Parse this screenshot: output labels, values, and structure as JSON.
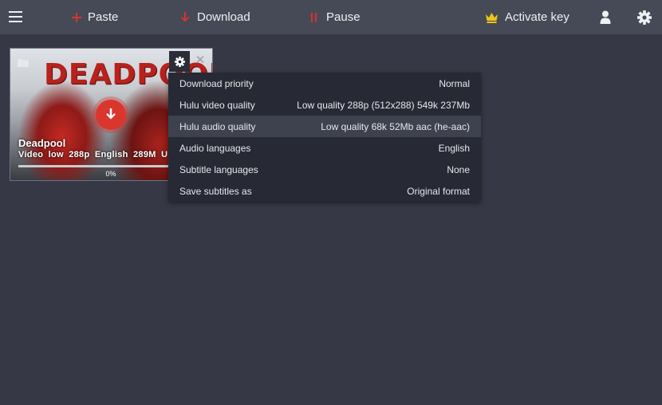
{
  "toolbar": {
    "paste_label": "Paste",
    "download_label": "Download",
    "pause_label": "Pause",
    "activate_label": "Activate key",
    "accent_color": "#d8342c",
    "key_color": "#f0c419"
  },
  "card": {
    "poster_text": "DEADPOOL",
    "title": "Deadpool",
    "meta": "Video  low  288p  English  289M  U",
    "progress_fraction": 0,
    "progress_label": "0%"
  },
  "menu": {
    "items": [
      {
        "label": "Download priority",
        "value": "Normal"
      },
      {
        "label": "Hulu video quality",
        "value": "Low quality 288p (512x288) 549k 237Mb"
      },
      {
        "label": "Hulu audio quality",
        "value": "Low quality 68k 52Mb aac (he-aac)"
      },
      {
        "label": "Audio languages",
        "value": "English"
      },
      {
        "label": "Subtitle languages",
        "value": "None"
      },
      {
        "label": "Save subtitles as",
        "value": "Original format"
      }
    ],
    "highlighted_index": 2
  },
  "icons": [
    "hamburger-icon",
    "plus-icon",
    "download-arrow-icon",
    "pause-icon",
    "crown-icon",
    "user-icon",
    "gear-icon",
    "folder-icon",
    "close-icon"
  ]
}
